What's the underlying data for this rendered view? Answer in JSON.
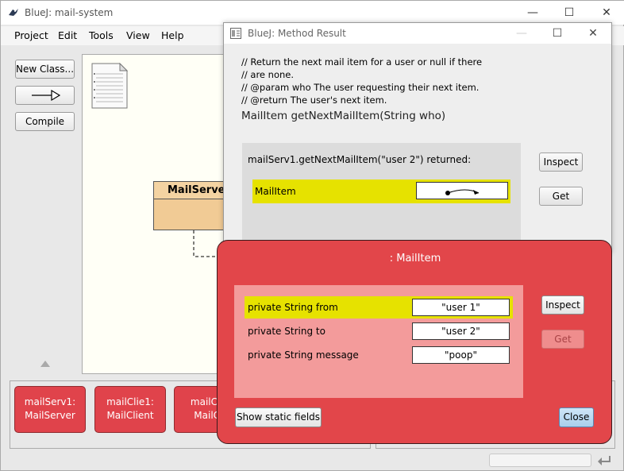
{
  "main_window": {
    "title": "BlueJ:  mail-system",
    "controls": {
      "minimize": "—",
      "maximize": "☐",
      "close": "✕"
    }
  },
  "menu": [
    "Project",
    "Edit",
    "Tools",
    "View",
    "Help"
  ],
  "toolbar": {
    "new_class": "New Class...",
    "compile": "Compile"
  },
  "class_diagram": {
    "class_name": "MailServer"
  },
  "object_bench": [
    {
      "line1": "mailServ1:",
      "line2": "MailServer"
    },
    {
      "line1": "mailClie1:",
      "line2": "MailClient"
    },
    {
      "line1": "mailClie",
      "line2": "MailCli"
    }
  ],
  "result_dialog": {
    "title": "BlueJ:  Method Result",
    "comment": [
      "// Return the next mail item for a user or null if there",
      "// are none.",
      "// @param who The user requesting their next item.",
      "// @return The user's next item."
    ],
    "signature": "MailItem getNextMailItem(String who)",
    "call": "mailServ1.getNextMailItem(\"user 2\") returned:",
    "return_type": "MailItem",
    "buttons": {
      "inspect": "Inspect",
      "get": "Get"
    }
  },
  "inspector": {
    "title": ": MailItem",
    "fields": [
      {
        "label": "private String from",
        "value": "\"user 1\""
      },
      {
        "label": "private String to",
        "value": "\"user 2\""
      },
      {
        "label": "private String message",
        "value": "\"poop\""
      }
    ],
    "buttons": {
      "inspect": "Inspect",
      "get": "Get",
      "show_static": "Show static fields",
      "close": "Close"
    }
  },
  "colors": {
    "object": "#e0434b",
    "inspector_bg": "#e2464a",
    "highlight": "#e6e200",
    "class_fill": "#f1cb95"
  }
}
